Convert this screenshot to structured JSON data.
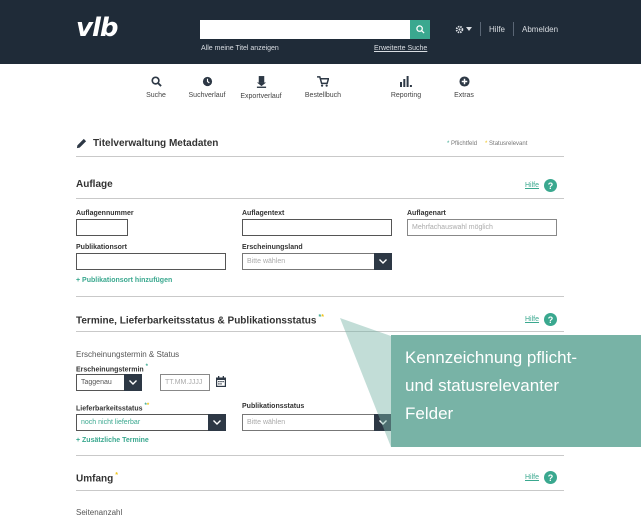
{
  "header": {
    "logo": "vlb",
    "search_placeholder": "",
    "search_link_all_titles": "Alle meine Titel anzeigen",
    "search_link_advanced": "Erweiterte Suche",
    "help": "Hilfe",
    "logout": "Abmelden"
  },
  "nav": [
    {
      "label": "Suche",
      "icon": "search-icon"
    },
    {
      "label": "Suchverlauf",
      "icon": "clock-icon"
    },
    {
      "label": "Exportverlauf",
      "icon": "export-icon"
    },
    {
      "label": "Bestellbuch",
      "icon": "cart-icon"
    },
    {
      "label": "Reporting",
      "icon": "bar-chart-icon"
    },
    {
      "label": "Extras",
      "icon": "plus-circle-icon"
    }
  ],
  "page": {
    "title": "Titelverwaltung Metadaten",
    "legend_required": "Pflichtfeld",
    "legend_status": "Statusrelevant",
    "star": "*",
    "double_star": "**"
  },
  "auflage": {
    "title": "Auflage",
    "help": "Hilfe",
    "fields": {
      "auflagennummer": "Auflagennummer",
      "auflagentext": "Auflagentext",
      "auflagenart": "Auflagenart",
      "auflagenart_placeholder": "Mehrfachauswahl möglich",
      "publikationsort": "Publikationsort",
      "erscheinungsland": "Erscheinungsland",
      "erscheinungsland_placeholder": "Bitte wählen"
    },
    "add_place": "+ Publikationsort hinzufügen"
  },
  "termine": {
    "title": "Termine, Lieferbarkeitsstatus & Publikationsstatus",
    "help": "Hilfe",
    "subheading": "Erscheinungstermin & Status",
    "erscheinungstermin": "Erscheinungstermin",
    "precision_value": "Taggenau",
    "date_placeholder": "TT.MM.JJJJ",
    "lieferbarkeitsstatus": "Lieferbarkeitsstatus",
    "lieferbarkeit_value": "noch nicht lieferbar",
    "publikationsstatus": "Publikationsstatus",
    "publikation_placeholder": "Bitte wählen",
    "add_dates": "+ Zusätzliche Termine"
  },
  "umfang": {
    "title": "Umfang",
    "help": "Hilfe",
    "seitenanzahl": "Seitenanzahl"
  },
  "callout": {
    "lines": [
      "Kennzeichnung pflicht-",
      "und statusrelevanter",
      "Felder"
    ]
  },
  "colors": {
    "topbar": "#1f2b38",
    "accent": "#3aa88f",
    "status_star": "#f0c419",
    "callout": "#78b3a6"
  }
}
